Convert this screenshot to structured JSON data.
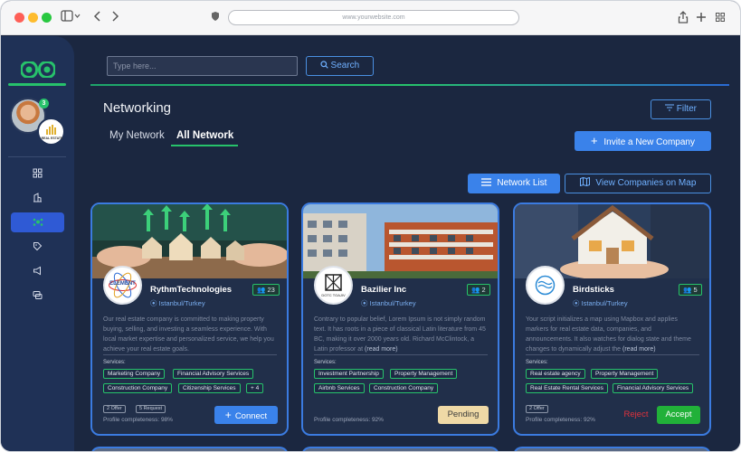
{
  "browser": {
    "url": "www.yourwebsite.com"
  },
  "sidebar": {
    "notification_count": "3",
    "company_badge_text": "REAL ESTATE",
    "items": [
      {
        "icon": "grid-icon"
      },
      {
        "icon": "building-icon"
      },
      {
        "icon": "network-icon",
        "active": true
      },
      {
        "icon": "tag-icon"
      },
      {
        "icon": "megaphone-icon"
      },
      {
        "icon": "chat-icon"
      }
    ]
  },
  "search": {
    "placeholder": "Type here...",
    "button_label": "Search"
  },
  "page": {
    "title": "Networking",
    "filter_label": "Filter",
    "tabs": [
      {
        "label": "My Network"
      },
      {
        "label": "All Network",
        "active": true
      }
    ],
    "invite_label": "Invite a New Company",
    "network_list_label": "Network List",
    "view_map_label": "View Companies on Map"
  },
  "cards": [
    {
      "name": "RythmTechnologies",
      "location": "Istanbul/Turkey",
      "count": "23",
      "logo_text": "ELEMENT",
      "description": "Our real estate company is committed to making property buying, selling, and investing a seamless experience. With local market expertise and personalized service, we help you achieve your real estate goals.",
      "services_label": "Services:",
      "services": [
        "Marketing Company",
        "Financial Advisory Services",
        "Construction Company",
        "Citizenship Services",
        "+ 4"
      ],
      "badges": [
        "2 Offer",
        "5 Request"
      ],
      "completeness": "Profile completeness: 98%",
      "action": "Connect"
    },
    {
      "name": "Bazilier Inc",
      "location": "Istanbul/Turkey",
      "count": "2",
      "logo_text": "DOTC TOAJIV",
      "description": "Contrary to popular belief, Lorem Ipsum is not simply random text. It has roots in a piece of classical Latin literature from 45 BC, making it over 2000 years old. Richard McClintock, a Latin professor at",
      "more": "(read more)",
      "services_label": "Services:",
      "services": [
        "Investment Partnership",
        "Property Management",
        "Airbnb Services",
        "Construction Company"
      ],
      "completeness": "Profile completeness: 92%",
      "action": "Pending"
    },
    {
      "name": "Birdsticks",
      "location": "Istanbul/Turkey",
      "count": "5",
      "description": "Your script initializes a map using Mapbox and applies markers for real estate data, companies, and announcements. It also watches for dialog state and theme changes to dynamically adjust the",
      "more": "(read more)",
      "services_label": "Services:",
      "services": [
        "Real estate agency",
        "Property Management",
        "Real Estate Rental Services",
        "Financial Advisory Services"
      ],
      "badges": [
        "2 Offer"
      ],
      "completeness": "Profile completeness: 92%",
      "reject": "Reject",
      "accept": "Accept"
    }
  ],
  "colors": {
    "accent_green": "#27c26b",
    "accent_blue": "#3a82ea",
    "background": "#1b2740",
    "sidebar": "#1f3156"
  }
}
